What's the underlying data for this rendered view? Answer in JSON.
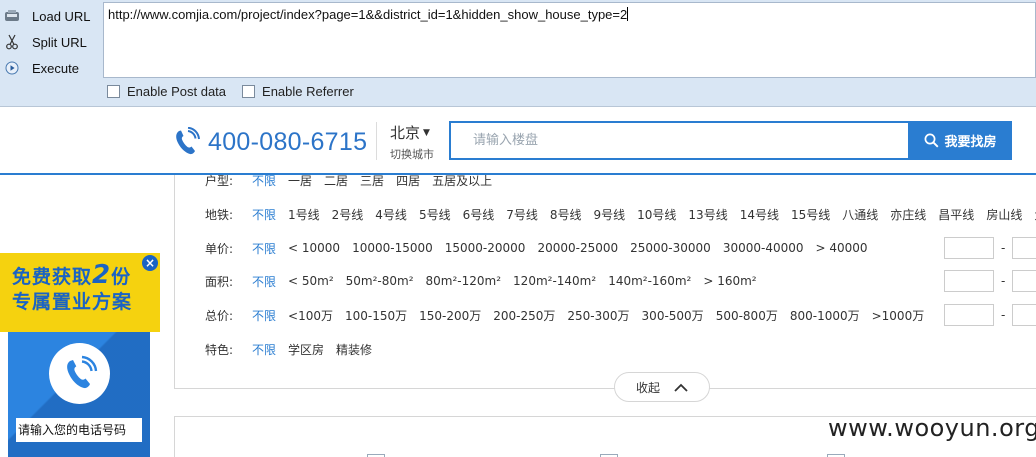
{
  "hackbar": {
    "buttons": [
      {
        "label": "Load URL",
        "icon": "load-url-icon"
      },
      {
        "label": "Split URL",
        "icon": "scissors-icon"
      },
      {
        "label": "Execute",
        "icon": "play-icon"
      }
    ],
    "url": "http://www.comjia.com/project/index?page=1&&district_id=1&hidden_show_house_type=2",
    "options": [
      {
        "label": "Enable Post data",
        "checked": false
      },
      {
        "label": "Enable Referrer",
        "checked": false
      }
    ]
  },
  "header": {
    "phone_number": "400-080-6715",
    "phone_icon": "telephone-icon",
    "city": "北京",
    "city_switch": "切换城市",
    "search_placeholder": "请输入楼盘",
    "search_button": "我要找房",
    "accent_color": "#2a7dd1"
  },
  "filters": {
    "rows": [
      {
        "label": "户型:",
        "items": [
          "不限",
          "一居",
          "二居",
          "三居",
          "四居",
          "五居及以上"
        ]
      },
      {
        "label": "地铁:",
        "items": [
          "不限",
          "1号线",
          "2号线",
          "4号线",
          "5号线",
          "6号线",
          "7号线",
          "8号线",
          "9号线",
          "10号线",
          "13号线",
          "14号线",
          "15号线",
          "八通线",
          "亦庄线",
          "昌平线",
          "房山线",
          "大"
        ]
      },
      {
        "label": "单价:",
        "items": [
          "不限",
          "< 10000",
          "10000-15000",
          "15000-20000",
          "20000-25000",
          "25000-30000",
          "30000-40000",
          "> 40000"
        ],
        "range_dash": "-"
      },
      {
        "label": "面积:",
        "items": [
          "不限",
          "< 50m²",
          "50m²-80m²",
          "80m²-120m²",
          "120m²-140m²",
          "140m²-160m²",
          "> 160m²"
        ],
        "range_dash": "-"
      },
      {
        "label": "总价:",
        "items": [
          "不限",
          "<100万",
          "100-150万",
          "150-200万",
          "200-250万",
          "250-300万",
          "300-500万",
          "500-800万",
          "800-1000万",
          ">1000万"
        ],
        "range_dash": "-"
      },
      {
        "label": "特色:",
        "items": [
          "不限",
          "学区房",
          "精装修"
        ]
      }
    ],
    "collapse_label": "收起"
  },
  "promo": {
    "line1_pre": "免费获取",
    "line1_num": "2",
    "line1_post": "份",
    "line2": "专属置业方案",
    "close": "×",
    "phone_placeholder": "请输入您的电话号码",
    "colors": {
      "yellow": "#f5d20f",
      "blue": "#2c84e0"
    }
  },
  "watermark": "www.wooyun.org"
}
